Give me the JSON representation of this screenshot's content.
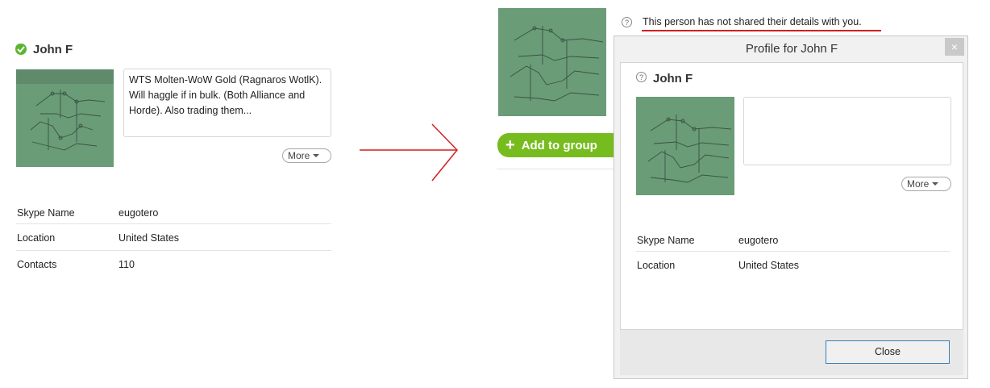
{
  "left_panel": {
    "contact_name": "John F",
    "mood_text": "WTS Molten-WoW Gold (Ragnaros WotlK). Will haggle if in bulk. (Both Alliance and Horde). Also trading them...",
    "more_label": "More",
    "fields": [
      {
        "label": "Skype Name",
        "value": "eugotero"
      },
      {
        "label": "Location",
        "value": "United States"
      },
      {
        "label": "Contacts",
        "value": "110"
      }
    ]
  },
  "right_panel": {
    "add_to_group_label": "Add to group",
    "privacy_notice": "This person has not shared their details with you."
  },
  "dialog": {
    "title": "Profile for John F",
    "close_x": "×",
    "contact_name": "John F",
    "mood_text": "",
    "more_label": "More",
    "fields": [
      {
        "label": "Skype Name",
        "value": "eugotero"
      },
      {
        "label": "Location",
        "value": "United States"
      }
    ],
    "close_button_label": "Close"
  },
  "colors": {
    "online_green": "#5cb531",
    "add_button_green": "#77bc1f",
    "annotation_red": "#d21f1f",
    "close_button_border": "#3c7fb1"
  },
  "icons": {
    "status": "online-status-icon",
    "plus": "plus-icon",
    "question": "question-circle-icon",
    "arrow": "right-arrow-annotation"
  }
}
